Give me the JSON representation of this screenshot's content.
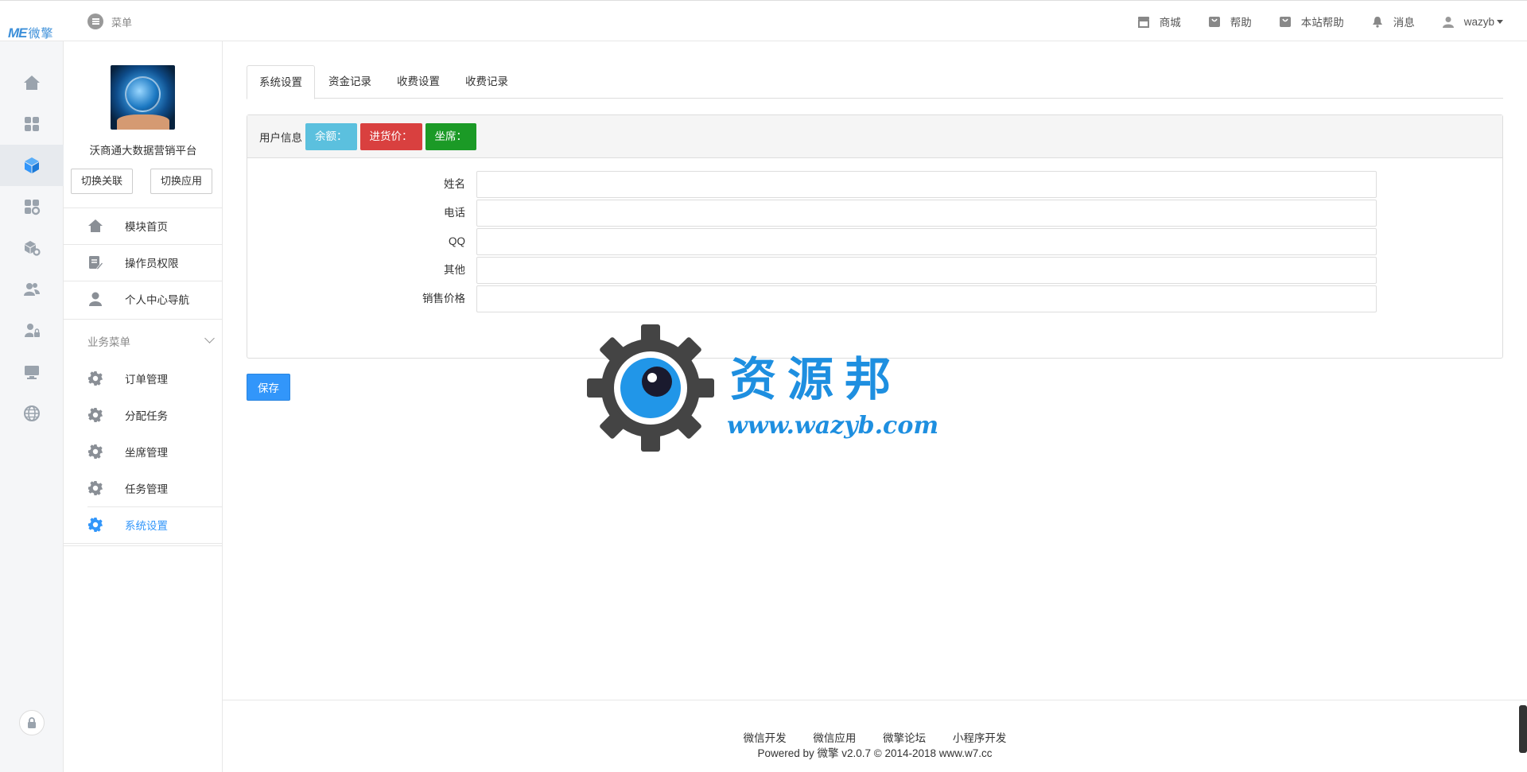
{
  "brand": {
    "logo_text": "ME",
    "logo_cn": "微擎"
  },
  "header": {
    "menu_label": "菜单",
    "nav": [
      {
        "label": "商城",
        "icon": "store-icon"
      },
      {
        "label": "帮助",
        "icon": "bag-icon"
      },
      {
        "label": "本站帮助",
        "icon": "bag-icon"
      },
      {
        "label": "消息",
        "icon": "bell-icon"
      }
    ],
    "user": "wazyb"
  },
  "rail": {
    "icons": [
      "home-icon",
      "grid-icon",
      "cube-icon",
      "apps-settings-icon",
      "box-settings-icon",
      "users-icon",
      "user-lock-icon",
      "monitor-icon",
      "globe-icon"
    ],
    "active_index": 2,
    "bottom_icon": "lock-icon"
  },
  "sidebar": {
    "platform_name": "沃商通大数据营销平台",
    "switch_link_label": "切换关联",
    "switch_app_label": "切换应用",
    "top_items": [
      {
        "label": "模块首页",
        "icon": "home-icon"
      },
      {
        "label": "操作员权限",
        "icon": "edit-doc-icon"
      },
      {
        "label": "个人中心导航",
        "icon": "user-icon"
      }
    ],
    "section_title": "业务菜单",
    "business_items": [
      {
        "label": "订单管理",
        "icon": "gear-icon"
      },
      {
        "label": "分配任务",
        "icon": "gear-icon"
      },
      {
        "label": "坐席管理",
        "icon": "gear-icon"
      },
      {
        "label": "任务管理",
        "icon": "gear-icon"
      },
      {
        "label": "系统设置",
        "icon": "gear-icon",
        "active": true
      }
    ]
  },
  "tabs": [
    "系统设置",
    "资金记录",
    "收费设置",
    "收费记录"
  ],
  "panel": {
    "heading": "用户信息",
    "badges": [
      {
        "label": "余额：",
        "color": "#5bc0de"
      },
      {
        "label": "进货价：",
        "color": "#d9403f"
      },
      {
        "label": "坐席：",
        "color": "#1b9a26"
      }
    ],
    "fields": [
      {
        "label": "姓名",
        "value": ""
      },
      {
        "label": "电话",
        "value": ""
      },
      {
        "label": "QQ",
        "value": ""
      },
      {
        "label": "其他",
        "value": ""
      },
      {
        "label": "销售价格",
        "value": ""
      }
    ]
  },
  "save_label": "保存",
  "footer": {
    "links": [
      "微信开发",
      "微信应用",
      "微擎论坛",
      "小程序开发"
    ],
    "copyright": "Powered by 微擎 v2.0.7 © 2014-2018 www.w7.cc"
  },
  "watermark": {
    "cn": "资源邦",
    "url": "www.wazyb.com"
  },
  "colors": {
    "accent": "#3296fa",
    "info": "#5bc0de",
    "danger": "#d9403f",
    "success": "#1b9a26"
  }
}
